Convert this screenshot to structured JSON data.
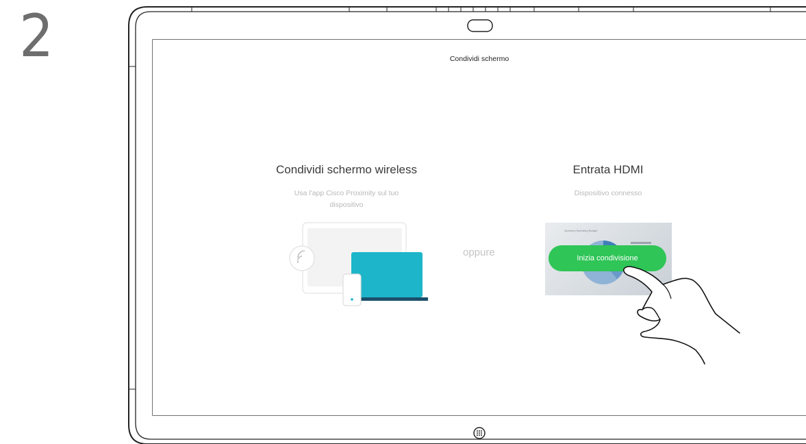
{
  "step": {
    "number": "2"
  },
  "screen": {
    "title": "Condividi schermo",
    "wireless": {
      "heading": "Condividi schermo wireless",
      "subtitle_line1": "Usa l'app Cisco Proximity sul tuo",
      "subtitle_line2": "dispositivo"
    },
    "separator": "oppure",
    "hdmi": {
      "heading": "Entrata HDMI",
      "subtitle": "Dispositivo connesso",
      "preview_caption": "Quarterly Spending Budget",
      "start_button": "Inizia condivisione"
    }
  },
  "colors": {
    "accent_green": "#2fc557",
    "laptop_teal": "#1db5c9",
    "laptop_base": "#1b4f6a"
  },
  "icons": [
    "wireless-share-icon",
    "home-icon",
    "camera-icon",
    "hand-pointer-icon"
  ]
}
